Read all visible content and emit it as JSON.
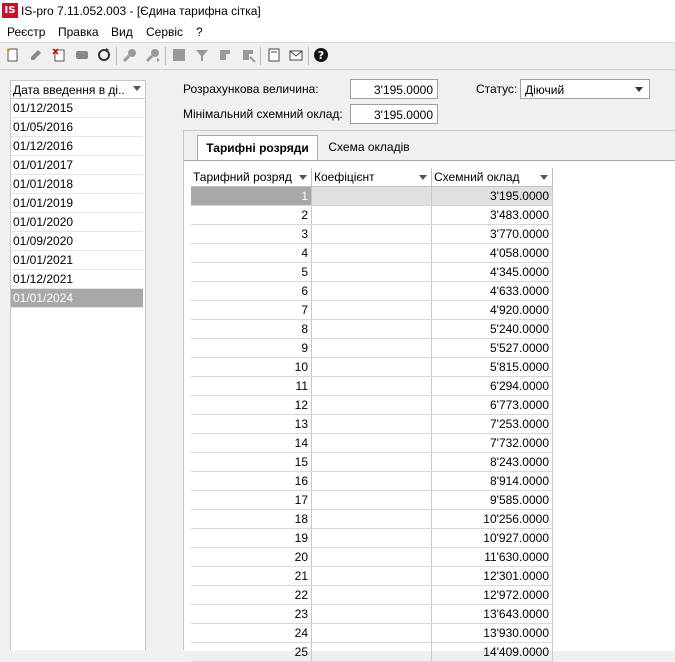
{
  "window": {
    "title": "IS-pro 7.11.052.003 - [Єдина тарифна сітка]",
    "logo": "IS"
  },
  "menu": [
    "Реєстр",
    "Правка",
    "Вид",
    "Сервіс",
    "?"
  ],
  "toolbar_icons": [
    "new-doc-icon",
    "edit-icon",
    "delete-icon",
    "copy-icon",
    "refresh-icon",
    "find-icon",
    "find-next-icon",
    "calc-icon",
    "filter-icon",
    "sort-icon",
    "sort2-icon",
    "print-icon",
    "mail-icon",
    "help-icon"
  ],
  "left_panel": {
    "header": "Дата введення в ді...",
    "dates": [
      "01/12/2015",
      "01/05/2016",
      "01/12/2016",
      "01/01/2017",
      "01/01/2018",
      "01/01/2019",
      "01/01/2020",
      "01/09/2020",
      "01/01/2021",
      "01/12/2021",
      "01/01/2024"
    ],
    "selected_index": 10
  },
  "form": {
    "calc_label": "Розрахункова величина:",
    "calc_value": "3'195.0000",
    "min_label": "Мінімальний схемний оклад:",
    "min_value": "3'195.0000",
    "status_label": "Статус:",
    "status_value": "Діючий"
  },
  "tabs": {
    "active": "Тарифні розряди",
    "inactive": "Схема окладів"
  },
  "grid": {
    "headers": [
      "Тарифний розряд",
      "Коефіцієнт",
      "Схемний оклад"
    ],
    "rows": [
      [
        "1",
        "",
        "3'195.0000"
      ],
      [
        "2",
        "",
        "3'483.0000"
      ],
      [
        "3",
        "",
        "3'770.0000"
      ],
      [
        "4",
        "",
        "4'058.0000"
      ],
      [
        "5",
        "",
        "4'345.0000"
      ],
      [
        "6",
        "",
        "4'633.0000"
      ],
      [
        "7",
        "",
        "4'920.0000"
      ],
      [
        "8",
        "",
        "5'240.0000"
      ],
      [
        "9",
        "",
        "5'527.0000"
      ],
      [
        "10",
        "",
        "5'815.0000"
      ],
      [
        "11",
        "",
        "6'294.0000"
      ],
      [
        "12",
        "",
        "6'773.0000"
      ],
      [
        "13",
        "",
        "7'253.0000"
      ],
      [
        "14",
        "",
        "7'732.0000"
      ],
      [
        "15",
        "",
        "8'243.0000"
      ],
      [
        "16",
        "",
        "8'914.0000"
      ],
      [
        "17",
        "",
        "9'585.0000"
      ],
      [
        "18",
        "",
        "10'256.0000"
      ],
      [
        "19",
        "",
        "10'927.0000"
      ],
      [
        "20",
        "",
        "11'630.0000"
      ],
      [
        "21",
        "",
        "12'301.0000"
      ],
      [
        "22",
        "",
        "12'972.0000"
      ],
      [
        "23",
        "",
        "13'643.0000"
      ],
      [
        "24",
        "",
        "13'930.0000"
      ],
      [
        "25",
        "",
        "14'409.0000"
      ]
    ],
    "selected_row": 0
  }
}
